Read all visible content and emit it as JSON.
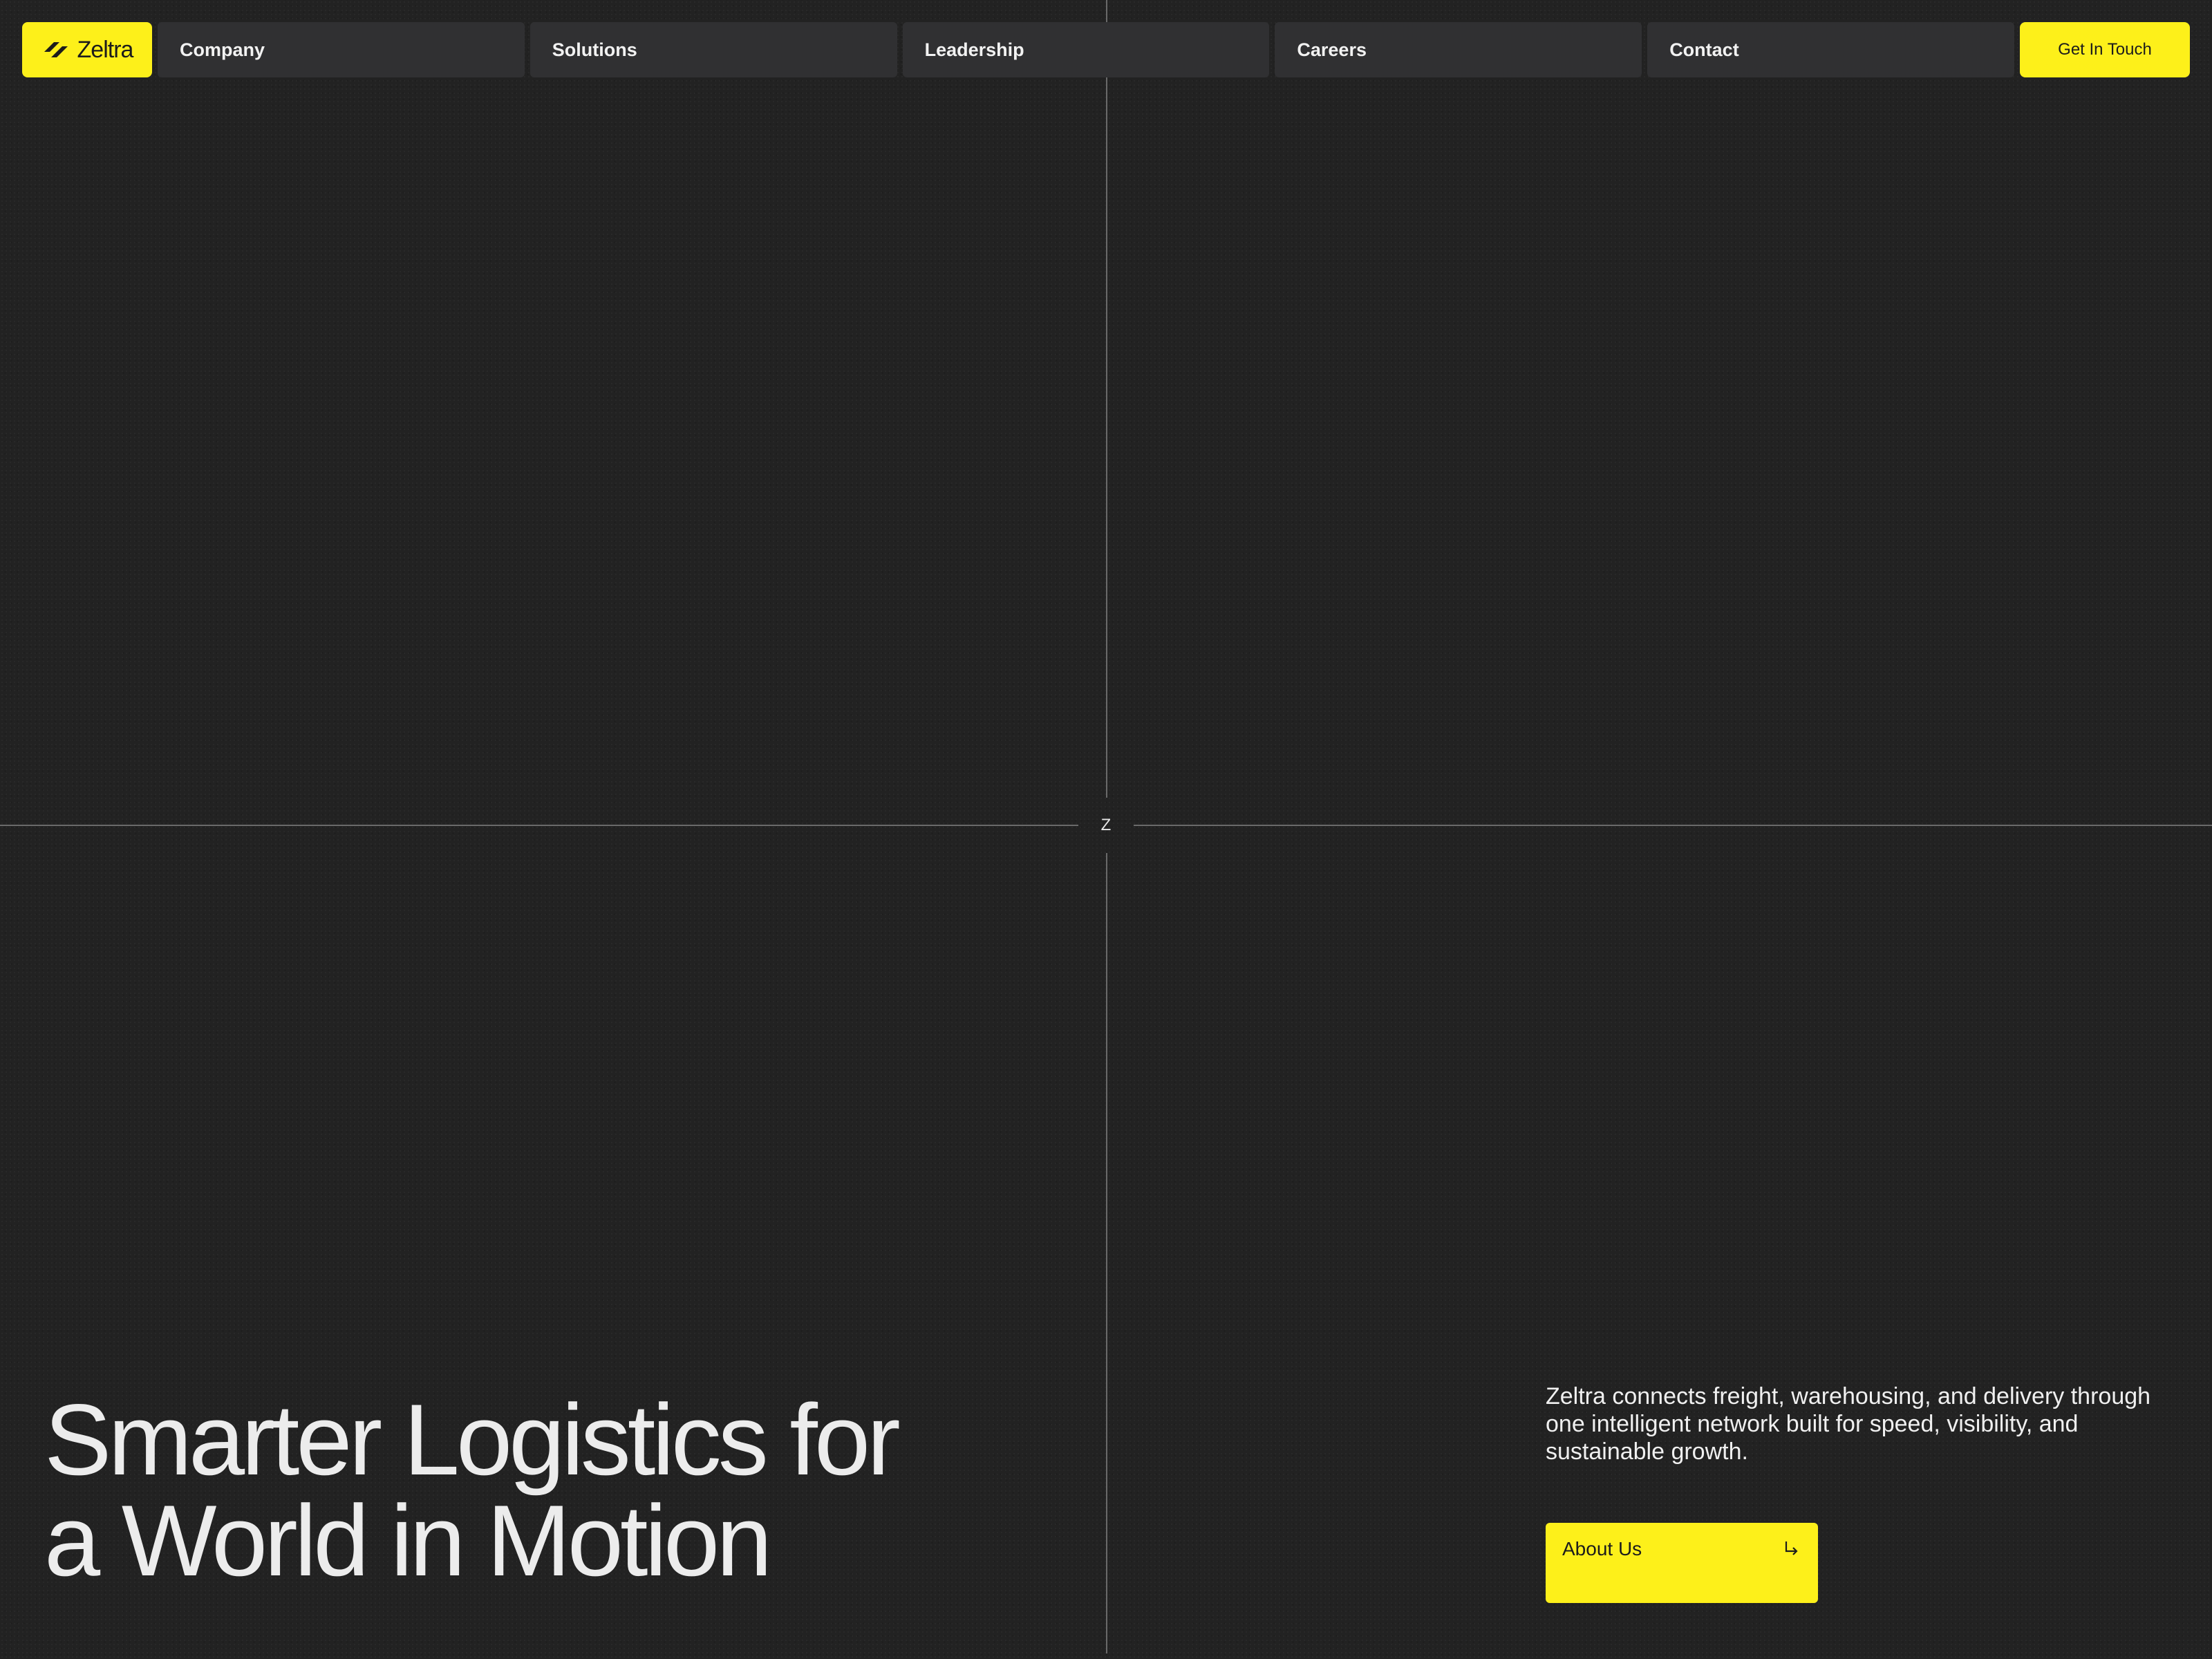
{
  "brand": {
    "name": "Zeltra",
    "accent_color": "#fdf01a",
    "background_color": "#222222",
    "logo_icon": "zeltra-logo-icon"
  },
  "nav": {
    "items": [
      {
        "label": "Company"
      },
      {
        "label": "Solutions"
      },
      {
        "label": "Leadership"
      },
      {
        "label": "Careers"
      },
      {
        "label": "Contact"
      }
    ],
    "cta_label": "Get In Touch"
  },
  "grid": {
    "center_mark": "Z"
  },
  "hero": {
    "headline_line1": "Smarter Logistics for",
    "headline_line2": "a World in Motion",
    "description": "Zeltra connects freight, warehousing, and delivery through one intelligent network built for speed, visibility, and sustainable growth.",
    "button_label": "About Us",
    "button_icon": "arrow-down-right-icon"
  }
}
